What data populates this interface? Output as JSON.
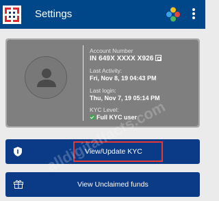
{
  "header": {
    "title": "Settings",
    "colors": {
      "bar": "#00478a",
      "logo_red": "#e4262f"
    }
  },
  "profile": {
    "account_number_label": "Account Number",
    "account_number": "IN 649X XXXX X926",
    "last_activity_label": "Last Activity:",
    "last_activity": "Fri, Nov 8, 19 04:43 PM",
    "last_login_label": "Last login:",
    "last_login": "Thu, Nov 7, 19 05:14 PM",
    "kyc_level_label": "KYC Level:",
    "kyc_level": "Full KYC user"
  },
  "actions": {
    "view_update_kyc": "View/Update KYC",
    "view_unclaimed_funds": "View Unclaimed funds"
  },
  "watermark": "alldigitalfacts.com",
  "icons": [
    "bank-logo-icon",
    "apps-grid-icon",
    "more-vertical-icon",
    "avatar-icon",
    "copy-icon",
    "check-circle-icon",
    "shield-icon",
    "gift-icon"
  ]
}
